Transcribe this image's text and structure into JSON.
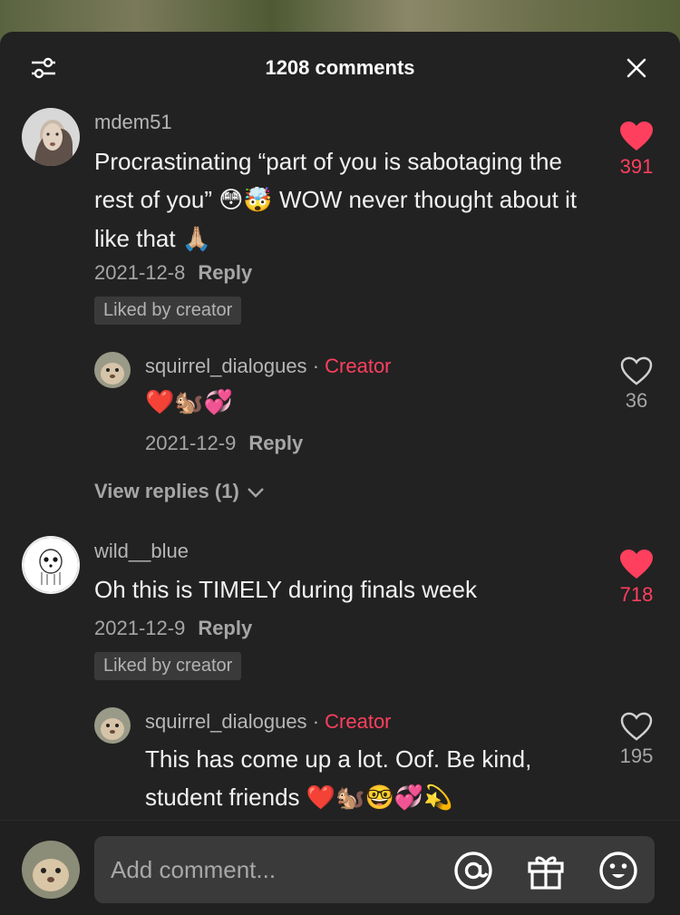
{
  "header": {
    "title": "1208 comments"
  },
  "comments": [
    {
      "username": "mdem51",
      "text": "Procrastinating “part of you is sabotaging the rest of you”",
      "text_emoji_1": "😳🤯",
      "text_2": "WOW never thought about it like that",
      "text_emoji_2": "🙏🏼",
      "date": "2021-12-8",
      "reply_label": "Reply",
      "liked_badge": "Liked by creator",
      "likes": "391",
      "reply": {
        "username": "squirrel_dialogues",
        "separator": "·",
        "creator_label": "Creator",
        "text": "❤️🐿️💞",
        "date": "2021-12-9",
        "reply_label": "Reply",
        "likes": "36"
      },
      "view_replies": "View replies (1)"
    },
    {
      "username": "wild__blue",
      "text": "Oh this is TIMELY during finals week",
      "date": "2021-12-9",
      "reply_label": "Reply",
      "liked_badge": "Liked by creator",
      "likes": "718",
      "reply": {
        "username": "squirrel_dialogues",
        "separator": "·",
        "creator_label": "Creator",
        "text": "This has come up a lot. Oof. Be kind,",
        "text_2": "student friends",
        "text_emoji": "❤️🐿️🤓💞💫",
        "likes": "195"
      }
    }
  ],
  "composer": {
    "placeholder": "Add comment..."
  },
  "colors": {
    "accent": "#ff3f5e",
    "sheet": "#222222",
    "muted": "#a6a6a6"
  },
  "icons": [
    "filter-icon",
    "close-icon",
    "heart-filled-icon",
    "heart-outline-icon",
    "chevron-down-icon",
    "at-mention-icon",
    "gift-icon",
    "emoji-face-icon"
  ]
}
